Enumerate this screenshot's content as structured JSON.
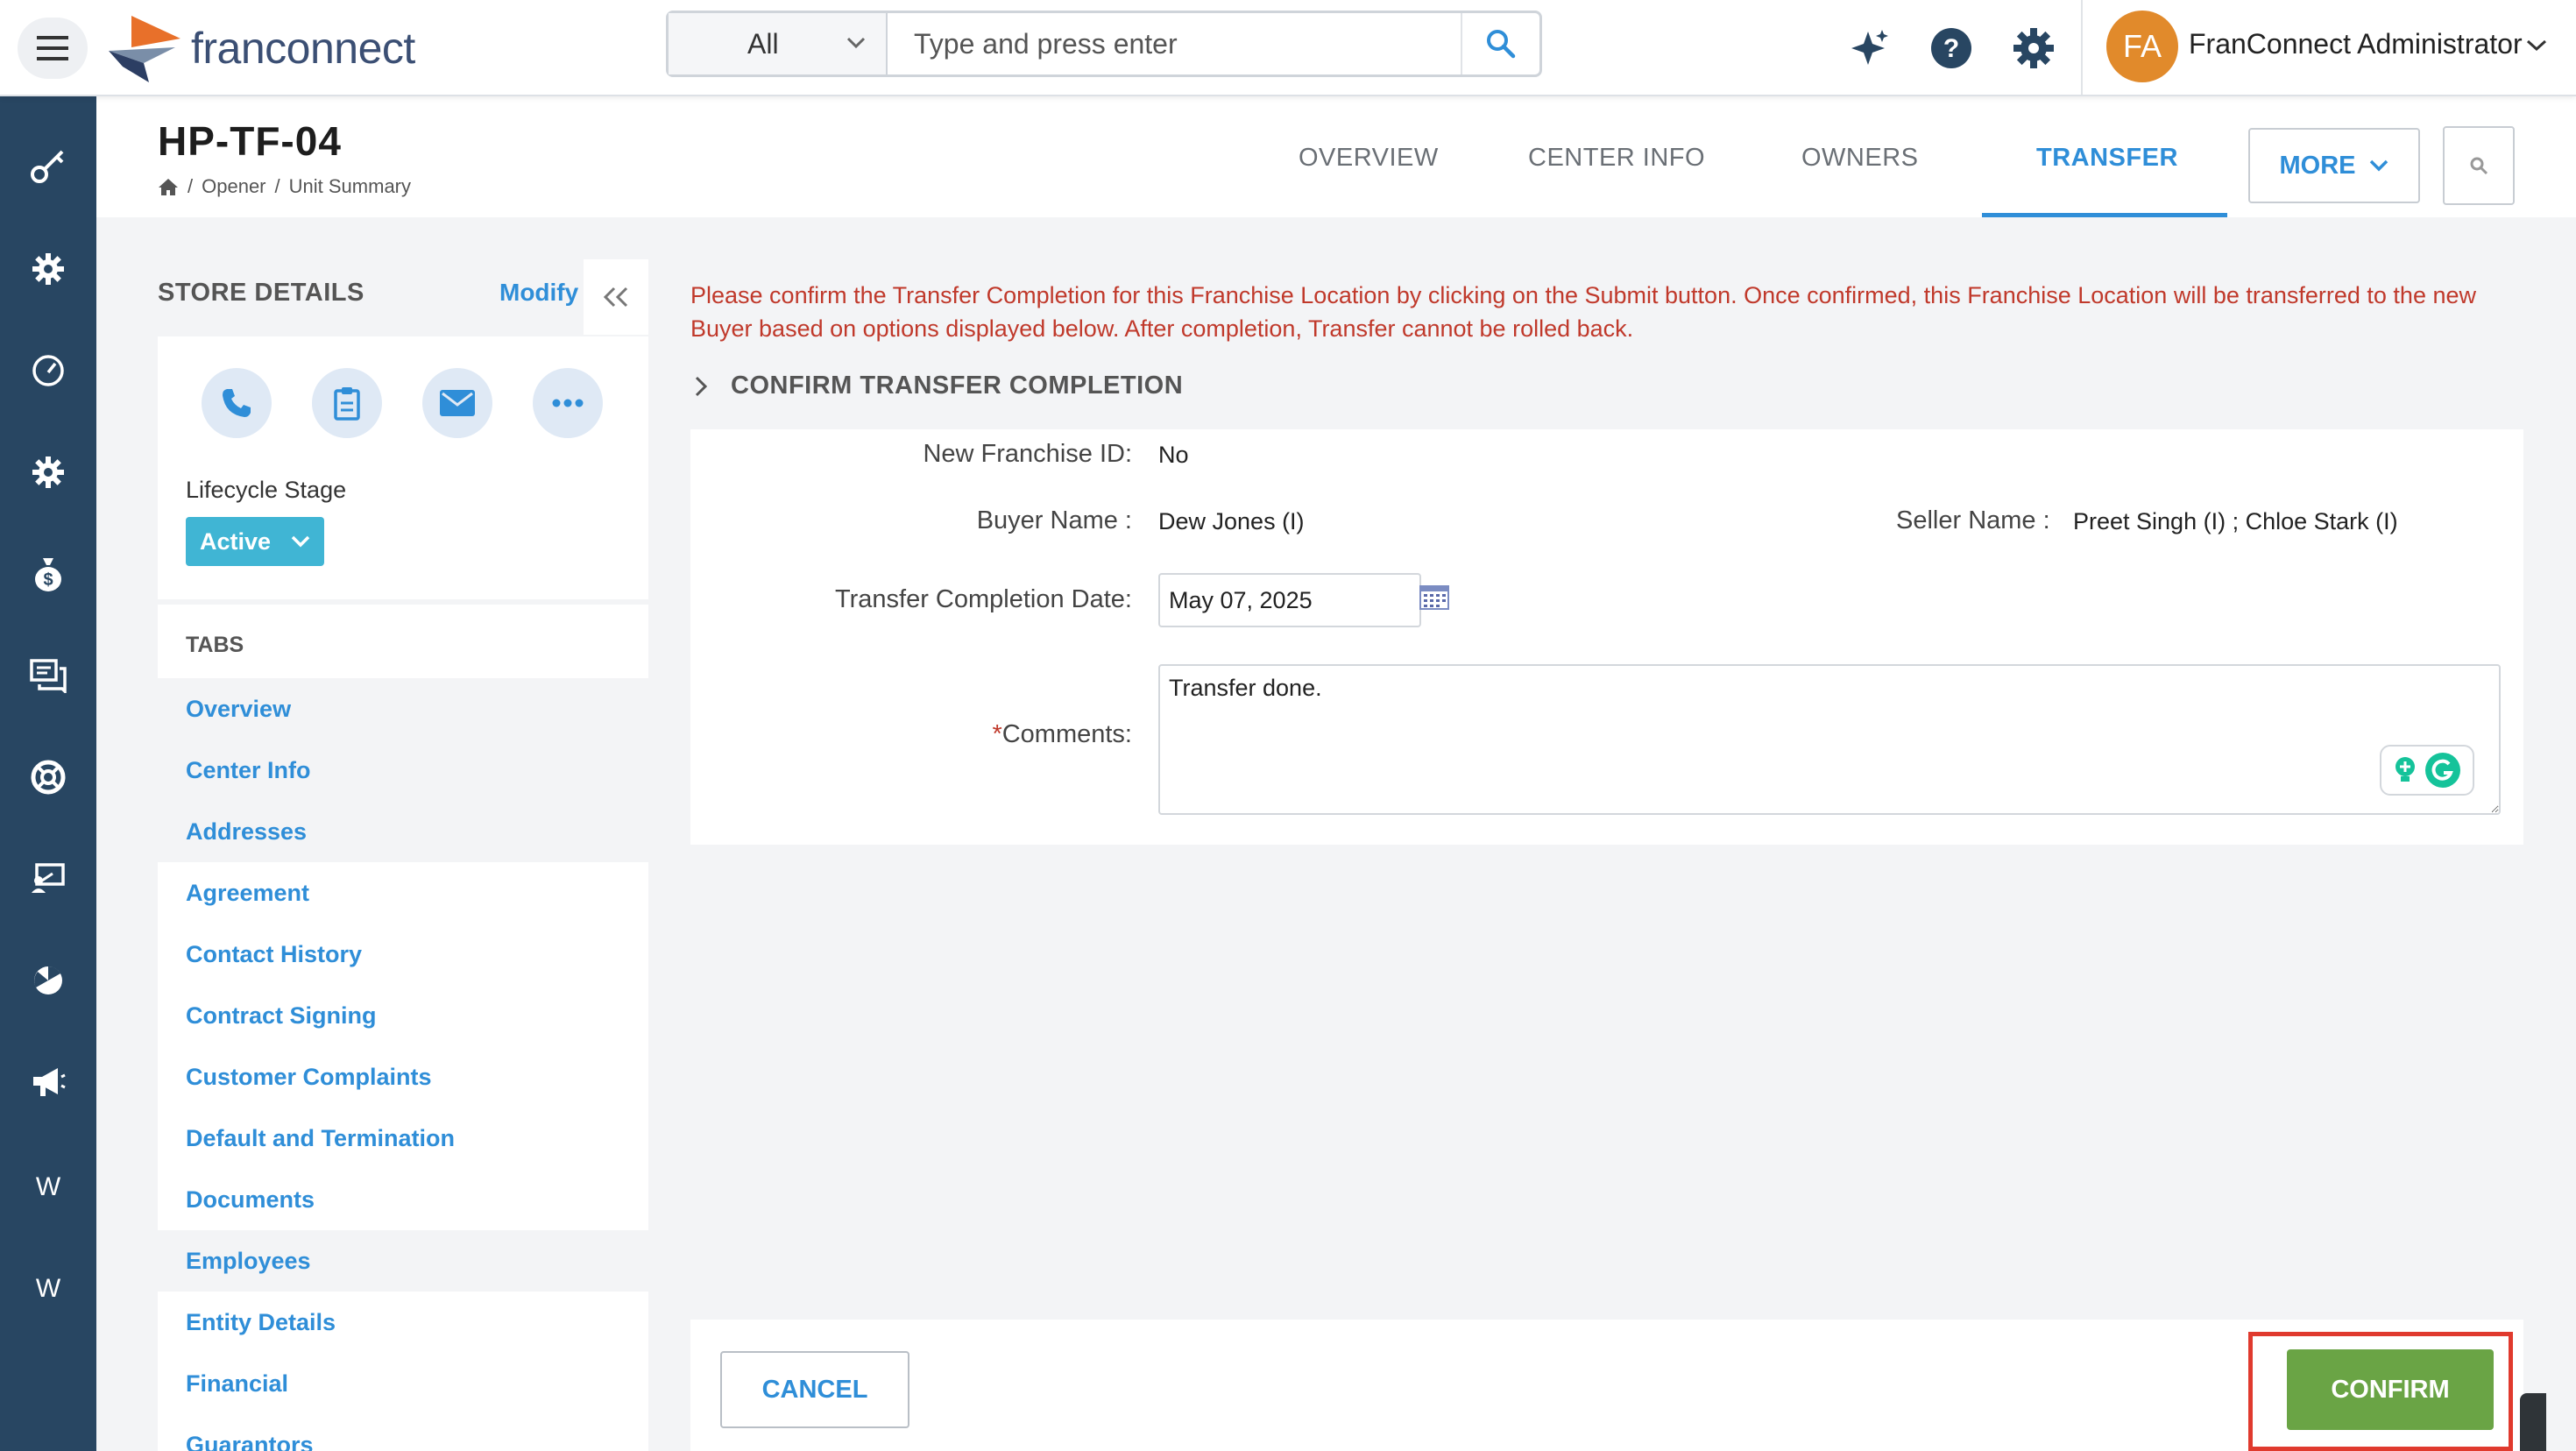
{
  "topbar": {
    "logo_text": "franconnect",
    "search": {
      "category": "All",
      "placeholder": "Type and press enter"
    },
    "user": {
      "initials": "FA",
      "name": "FranConnect Administrator"
    },
    "colors": {
      "nav_bg": "#284662",
      "accent": "#2f8ed8",
      "avatar": "#e18a2b"
    }
  },
  "leftnav": {
    "items": [
      "key-icon",
      "gear-icon",
      "dashboard-icon",
      "settings-icon",
      "money-bag-icon",
      "chat-icon",
      "support-icon",
      "training-icon",
      "analytics-icon",
      "megaphone-icon",
      "W",
      "W"
    ]
  },
  "header": {
    "title": "HP-TF-04",
    "breadcrumb": [
      "Opener",
      "Unit Summary"
    ],
    "tabs": [
      "OVERVIEW",
      "CENTER INFO",
      "OWNERS",
      "TRANSFER"
    ],
    "active_tab": "TRANSFER",
    "more_label": "MORE"
  },
  "store": {
    "title": "STORE DETAILS",
    "modify_label": "Modify",
    "lifecycle_label": "Lifecycle Stage",
    "lifecycle_value": "Active",
    "tabs_heading": "TABS",
    "tab_items": [
      "Overview",
      "Center Info",
      "Addresses",
      "Agreement",
      "Contact History",
      "Contract Signing",
      "Customer Complaints",
      "Default and Termination",
      "Documents",
      "Employees",
      "Entity Details",
      "Financial",
      "Guarantors"
    ]
  },
  "main": {
    "notice": "Please confirm the Transfer Completion for this Franchise Location by clicking on the Submit button. Once confirmed, this Franchise Location will be transferred to the new Buyer based on options displayed below. After completion, Transfer cannot be rolled back.",
    "section_title": "CONFIRM TRANSFER COMPLETION",
    "fields": {
      "new_franchise_id_label": "New Franchise ID:",
      "new_franchise_id_value": "No",
      "buyer_label": "Buyer Name :",
      "buyer_value": "Dew Jones (I)",
      "seller_label": "Seller Name :",
      "seller_value": "Preet Singh (I) ; Chloe Stark (I)",
      "date_label": "Transfer Completion Date:",
      "date_value": "May 07, 2025",
      "comments_required": "*",
      "comments_label": "Comments:",
      "comments_value": "Transfer done."
    },
    "cancel_label": "CANCEL",
    "confirm_label": "CONFIRM"
  }
}
